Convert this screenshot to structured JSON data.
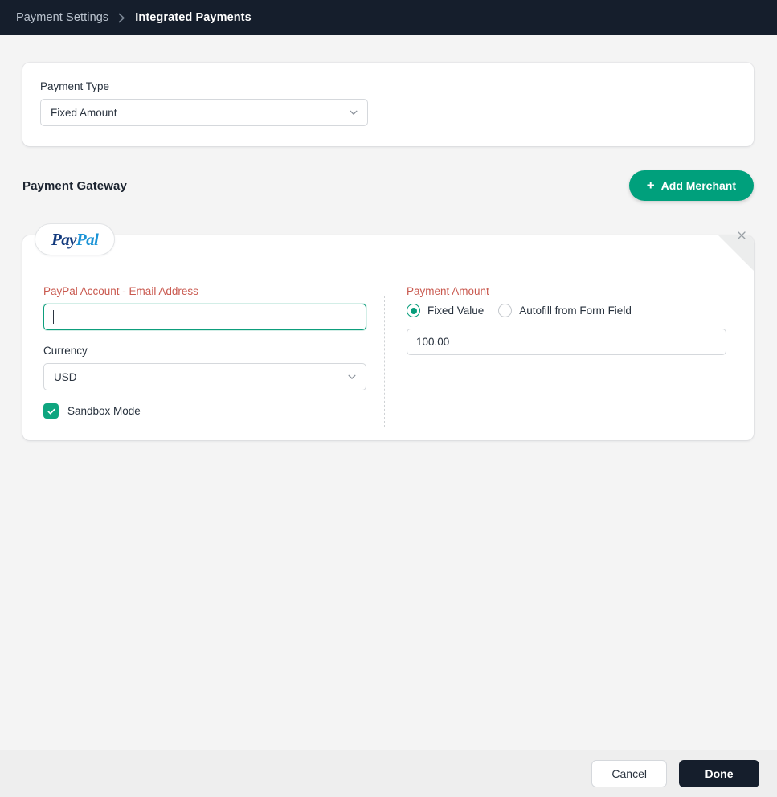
{
  "breadcrumb": {
    "parent": "Payment Settings",
    "separator_icon": "chevron-right-icon",
    "current": "Integrated Payments"
  },
  "payment_type": {
    "label": "Payment Type",
    "value": "Fixed Amount",
    "options": [
      "Fixed Amount"
    ],
    "chevron_icon": "chevron-down-icon"
  },
  "gateway": {
    "title": "Payment Gateway",
    "add_button": {
      "label": "Add Merchant",
      "plus_icon": "plus-icon"
    }
  },
  "merchant": {
    "tab_label_a": "Pay",
    "tab_label_b": "Pal",
    "close_icon": "close-icon",
    "left": {
      "email_label": "PayPal Account - Email Address",
      "email_value": "",
      "email_placeholder": "",
      "currency_label": "Currency",
      "currency_value": "USD",
      "currency_options": [
        "USD"
      ],
      "chevron_icon": "chevron-down-icon",
      "sandbox_label": "Sandbox Mode",
      "sandbox_checked": true,
      "check_icon": "check-icon"
    },
    "right": {
      "amount_label": "Payment Amount",
      "radio_fixed_label": "Fixed Value",
      "radio_autofill_label": "Autofill from Form Field",
      "selected_radio": "Fixed Value",
      "amount_value": "100.00"
    }
  },
  "footer": {
    "cancel_label": "Cancel",
    "done_label": "Done"
  },
  "colors": {
    "accent_teal": "#00a07c",
    "header_dark": "#151e2c",
    "error_red": "#c9594f",
    "page_bg": "#f4f4f4",
    "footer_bg": "#eeeeee",
    "paypal_blue_dark": "#123a7d",
    "paypal_blue_light": "#1a93d6"
  }
}
